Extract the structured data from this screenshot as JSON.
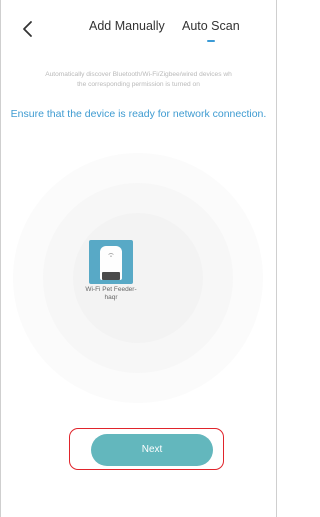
{
  "header": {
    "back_icon": "chevron-left-icon",
    "tabs": [
      {
        "label": "Add Manually",
        "selected": false
      },
      {
        "label": "Auto Scan",
        "selected": true
      }
    ]
  },
  "description": {
    "line1": "Automatically discover Bluetooth/Wi-Fi/Zigbee/wired devices wh",
    "line2": "the corresponding permission is turned on"
  },
  "ensure_text": "Ensure that the device is ready for network connection.",
  "device": {
    "name": "Wi-Fi Pet Feeder-haqr",
    "icon": "wifi-icon",
    "tile_color": "#58a9c6"
  },
  "next_button": {
    "label": "Next",
    "color": "#63b7bd",
    "highlight_color": "#e0242b"
  },
  "accent_color": "#3e9bd1"
}
